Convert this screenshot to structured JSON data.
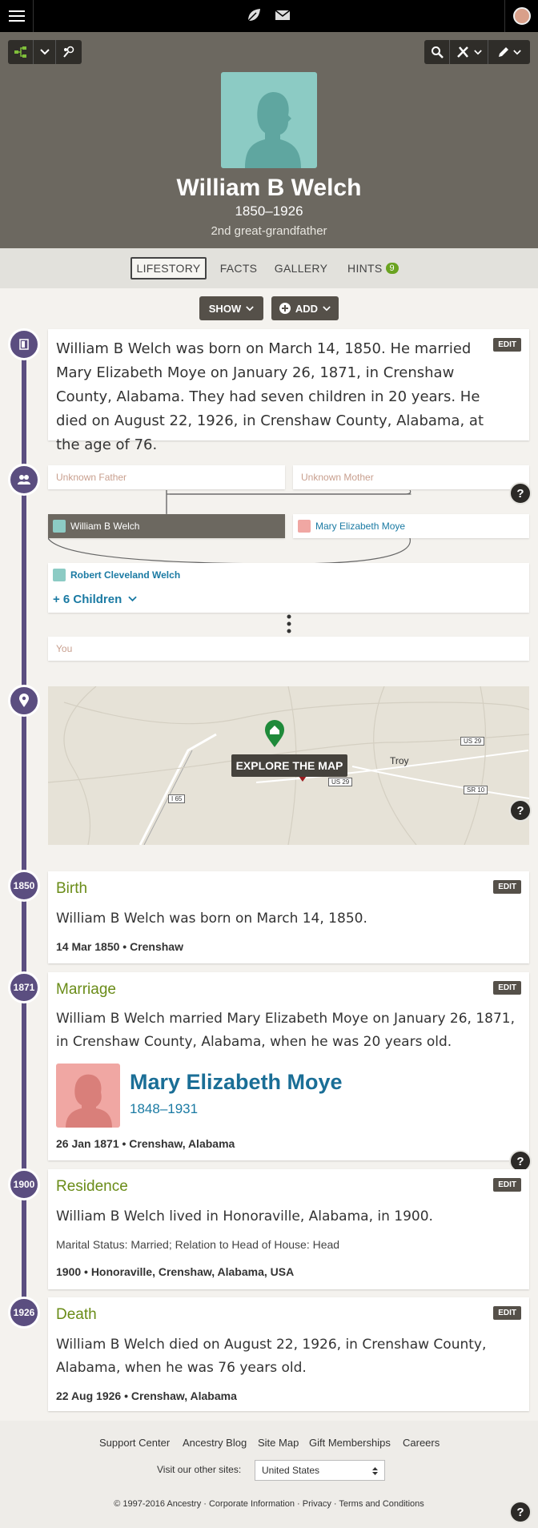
{
  "header": {
    "menu_icon": "hamburger-icon",
    "center_icons": [
      "leaf-icon",
      "mail-icon"
    ],
    "profile_icon": "user-avatar"
  },
  "toolbar": {
    "left_icons": [
      "tree-view-icon",
      "chevron-down-icon",
      "person-search-icon"
    ],
    "right_icons": [
      "search-icon",
      "tools-icon",
      "chevron-down-icon",
      "pencil-icon",
      "chevron-down-icon"
    ]
  },
  "person": {
    "name": "William B Welch",
    "dates": "1850–1926",
    "relationship": "2nd great-grandfather"
  },
  "tabs": [
    {
      "label": "LIFESTORY",
      "active": true
    },
    {
      "label": "FACTS",
      "active": false
    },
    {
      "label": "GALLERY",
      "active": false
    },
    {
      "label": "HINTS",
      "active": false,
      "badge": "9"
    }
  ],
  "actions": {
    "show_label": "SHOW",
    "add_label": "ADD"
  },
  "lifestory": {
    "text": "William B Welch was born on March 14, 1850. He married Mary Elizabeth Moye on January 26, 1871, in Crenshaw County, Alabama. They had seven children in 20 years. He died on August 22, 1926, in Crenshaw County, Alabama, at the age of 76.",
    "edit_label": "EDIT"
  },
  "family": {
    "father": "Unknown Father",
    "mother": "Unknown Mother",
    "self": "William B Welch",
    "spouse": "Mary Elizabeth Moye",
    "child": "Robert Cleveland Welch",
    "more_children": "+ 6 Children",
    "you": "You"
  },
  "map": {
    "button_label": "EXPLORE THE MAP",
    "labels": [
      "Troy",
      "US 29",
      "US 29",
      "SR 10",
      "I 65"
    ]
  },
  "events": [
    {
      "year": "1850",
      "title": "Birth",
      "desc": "William B Welch was born on March 14, 1850.",
      "foot": "14 Mar 1850 • Crenshaw"
    },
    {
      "year": "1871",
      "title": "Marriage",
      "desc": "William B Welch married Mary Elizabeth Moye on January 26, 1871, in Crenshaw County, Alabama, when he was 20 years old.",
      "spouse_name": "Mary Elizabeth Moye",
      "spouse_dates": "1848–1931",
      "foot": "26 Jan 1871 • Crenshaw, Alabama"
    },
    {
      "year": "1900",
      "title": "Residence",
      "desc": "William B Welch lived in Honoraville, Alabama, in 1900.",
      "extra": "Marital Status: Married; Relation to Head of House: Head",
      "foot": "1900 • Honoraville, Crenshaw, Alabama, USA"
    },
    {
      "year": "1926",
      "title": "Death",
      "desc": "William B Welch died on August 22, 1926, in Crenshaw County, Alabama, when he was 76 years old.",
      "foot": "22 Aug 1926 • Crenshaw, Alabama"
    }
  ],
  "edit_label": "EDIT",
  "help_label": "?",
  "footer": {
    "links": [
      "Support Center",
      "Ancestry Blog",
      "Site Map",
      "Gift Memberships",
      "Careers"
    ],
    "visit_label": "Visit our other sites:",
    "site_select": "United States",
    "legal": [
      "© 1997-2016 Ancestry",
      "Corporate Information",
      "Privacy",
      "Terms and Conditions"
    ]
  },
  "colors": {
    "timeline": "#5b4e80",
    "event_title": "#6a8c18",
    "link": "#1a7aa3",
    "hero_bg": "#6c6860"
  }
}
